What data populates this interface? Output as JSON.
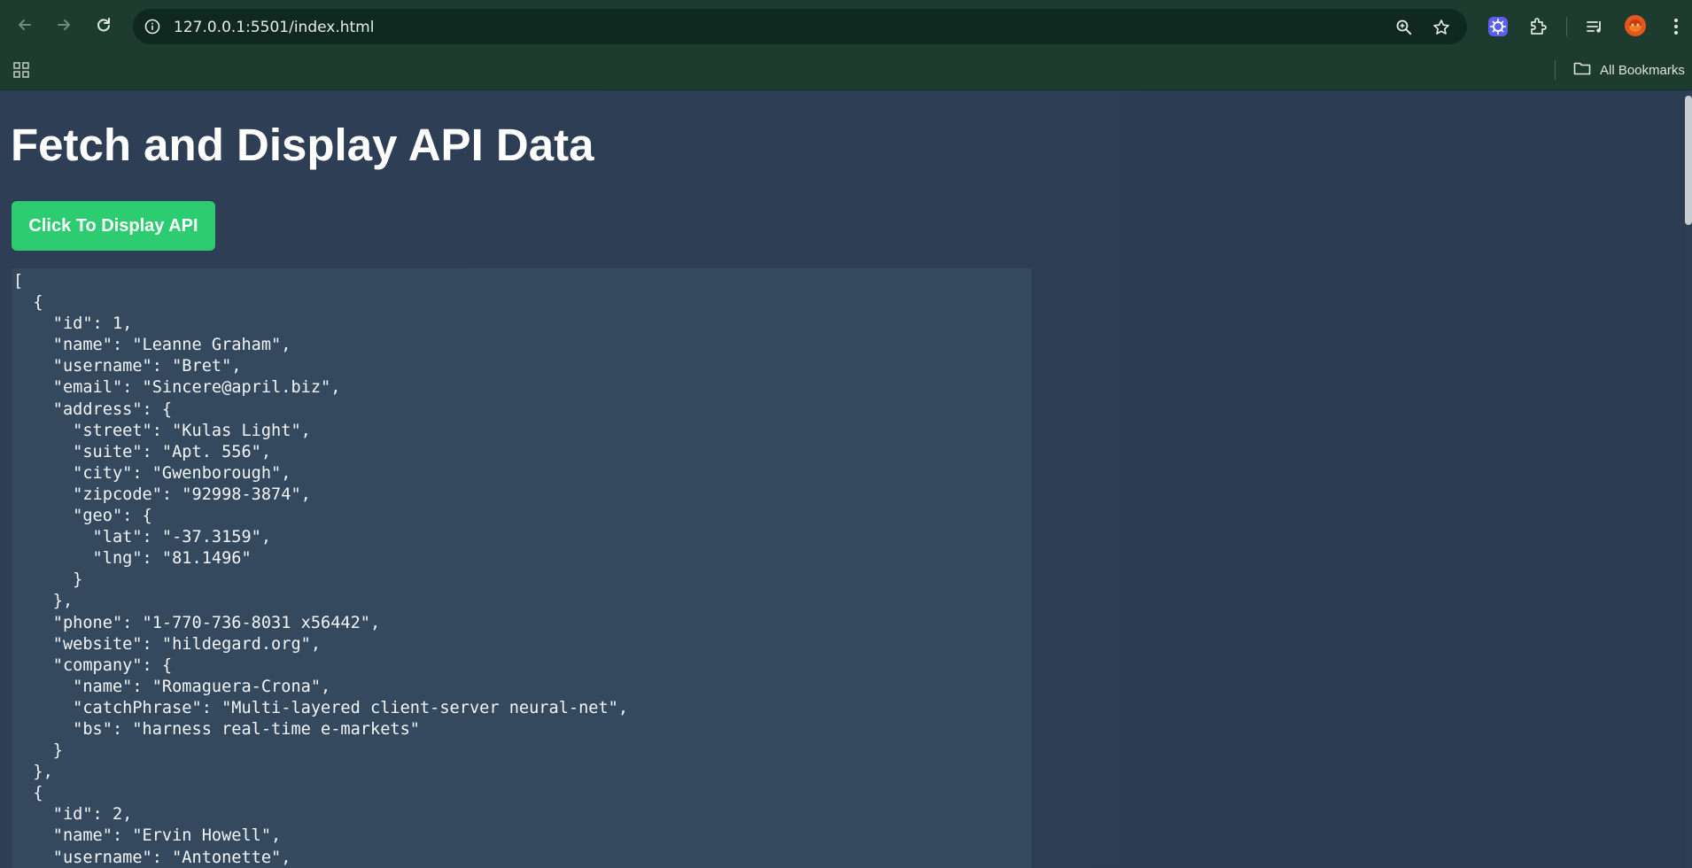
{
  "browser": {
    "url": "127.0.0.1:5501/index.html",
    "bookmarks_label": "All Bookmarks",
    "icons": [
      "back-arrow-icon",
      "forward-arrow-icon",
      "reload-icon",
      "site-info-icon",
      "zoom-icon",
      "star-icon",
      "extension-icon",
      "puzzle-icon",
      "media-icon",
      "profile-avatar-icon",
      "kebab-menu-icon",
      "apps-grid-icon",
      "folder-icon"
    ],
    "colors": {
      "chrome": "#1e3b30",
      "omnibox": "#0f2820"
    }
  },
  "page": {
    "title": "Fetch and Display API Data",
    "button_label": "Click To Display API",
    "output_text": "[\n  {\n    \"id\": 1,\n    \"name\": \"Leanne Graham\",\n    \"username\": \"Bret\",\n    \"email\": \"Sincere@april.biz\",\n    \"address\": {\n      \"street\": \"Kulas Light\",\n      \"suite\": \"Apt. 556\",\n      \"city\": \"Gwenborough\",\n      \"zipcode\": \"92998-3874\",\n      \"geo\": {\n        \"lat\": \"-37.3159\",\n        \"lng\": \"81.1496\"\n      }\n    },\n    \"phone\": \"1-770-736-8031 x56442\",\n    \"website\": \"hildegard.org\",\n    \"company\": {\n      \"name\": \"Romaguera-Crona\",\n      \"catchPhrase\": \"Multi-layered client-server neural-net\",\n      \"bs\": \"harness real-time e-markets\"\n    }\n  },\n  {\n    \"id\": 2,\n    \"name\": \"Ervin Howell\",\n    \"username\": \"Antonette\",",
    "colors": {
      "background": "#2c3e50",
      "button": "#2ecc71",
      "output_bg": "#34495e"
    }
  }
}
